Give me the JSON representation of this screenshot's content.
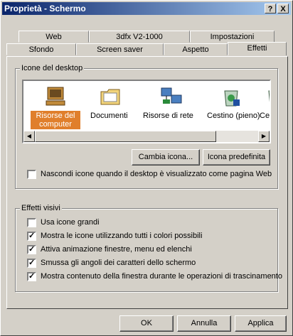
{
  "window": {
    "title": "Proprietà - Schermo",
    "help_glyph": "?",
    "close_glyph": "X"
  },
  "tabs_row1": [
    {
      "label": "Web"
    },
    {
      "label": "3dfx V2-1000"
    },
    {
      "label": "Impostazioni"
    }
  ],
  "tabs_row2": [
    {
      "label": "Sfondo"
    },
    {
      "label": "Screen saver"
    },
    {
      "label": "Aspetto"
    },
    {
      "label": "Effetti",
      "active": true
    }
  ],
  "desktop_icons": {
    "group_label": "Icone del desktop",
    "items": [
      {
        "label": "Risorse del computer",
        "icon": "computer-icon",
        "selected": true
      },
      {
        "label": "Documenti",
        "icon": "folder-icon"
      },
      {
        "label": "Risorse di rete",
        "icon": "network-icon"
      },
      {
        "label": "Cestino (pieno)",
        "icon": "recycle-bin-full-icon"
      },
      {
        "label": "Cestin",
        "icon": "recycle-bin-empty-icon"
      }
    ],
    "change_icon_button": "Cambia icona...",
    "default_icon_button": "Icona predefinita",
    "hide_icons_checkbox": {
      "label": "Nascondi icone quando il desktop è visualizzato come pagina Web",
      "checked": false
    }
  },
  "visual_effects": {
    "group_label": "Effetti visivi",
    "options": [
      {
        "label": "Usa icone grandi",
        "checked": false
      },
      {
        "label": "Mostra le icone utilizzando tutti i colori possibili",
        "checked": true
      },
      {
        "label": "Attiva animazione finestre, menu ed elenchi",
        "checked": true
      },
      {
        "label": "Smussa gli angoli dei caratteri dello schermo",
        "checked": true
      },
      {
        "label": "Mostra contenuto della finestra durante le operazioni di trascinamento",
        "checked": true
      }
    ]
  },
  "footer": {
    "ok": "OK",
    "cancel": "Annulla",
    "apply": "Applica"
  },
  "colors": {
    "title_start": "#0a246a",
    "title_end": "#a6caf0",
    "face": "#d4d0c8",
    "selection": "#e07f2c"
  }
}
